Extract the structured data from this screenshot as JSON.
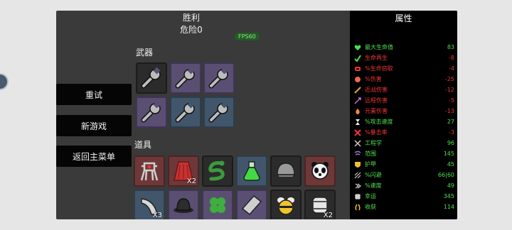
{
  "header": {
    "title": "胜利",
    "danger": "危险0",
    "fps": "FPS60"
  },
  "menu": {
    "retry": "重试",
    "new_game": "新游戏",
    "main_menu": "返回主菜单"
  },
  "weapons": {
    "label": "武器",
    "slots": [
      {
        "icon": "wrench-icon",
        "tier": "common"
      },
      {
        "icon": "wrench-icon",
        "tier": "epic"
      },
      {
        "icon": "wrench-icon",
        "tier": "epic"
      },
      {
        "icon": "wrench-icon",
        "tier": "epic"
      },
      {
        "icon": "wrench-icon",
        "tier": "rare"
      },
      {
        "icon": "wrench-icon",
        "tier": "rare"
      }
    ]
  },
  "items": {
    "label": "道具",
    "slots": [
      {
        "icon": "robot-frame-icon",
        "tier": "legendary",
        "count": ""
      },
      {
        "icon": "red-cape-icon",
        "tier": "legendary",
        "count": "X2"
      },
      {
        "icon": "snake-icon",
        "tier": "common",
        "count": ""
      },
      {
        "icon": "potion-icon",
        "tier": "rare",
        "count": ""
      },
      {
        "icon": "helmet-icon",
        "tier": "common",
        "count": ""
      },
      {
        "icon": "panda-icon",
        "tier": "common",
        "count": ""
      },
      {
        "icon": "horn-icon",
        "tier": "rare",
        "count": "X3"
      },
      {
        "icon": "bowler-hat-icon",
        "tier": "epic",
        "count": ""
      },
      {
        "icon": "clover-icon",
        "tier": "epic",
        "count": ""
      },
      {
        "icon": "crystal-icon",
        "tier": "epic",
        "count": ""
      },
      {
        "icon": "bee-icon",
        "tier": "common",
        "count": ""
      },
      {
        "icon": "barrel-icon",
        "tier": "common",
        "count": "X2"
      }
    ]
  },
  "stats": {
    "title": "属性",
    "rows": [
      {
        "icon": "heart-icon",
        "name": "最大生命值",
        "value": "83",
        "color": "#4ee04e"
      },
      {
        "icon": "regen-icon",
        "name": "生命再生",
        "value": "-8",
        "color": "#ef3535"
      },
      {
        "icon": "lifesteal-icon",
        "name": "%生命窃取",
        "value": "-4",
        "color": "#ef3535"
      },
      {
        "icon": "damage-icon",
        "name": "%伤害",
        "value": "-25",
        "color": "#ef3535"
      },
      {
        "icon": "melee-icon",
        "name": "近战伤害",
        "value": "-12",
        "color": "#ef3535"
      },
      {
        "icon": "ranged-icon",
        "name": "远程伤害",
        "value": "-5",
        "color": "#ef3535"
      },
      {
        "icon": "elemental-icon",
        "name": "元素伤害",
        "value": "-13",
        "color": "#ef3535"
      },
      {
        "icon": "attack-speed-icon",
        "name": "%攻击速度",
        "value": "27",
        "color": "#4ee04e"
      },
      {
        "icon": "crit-icon",
        "name": "%暴击率",
        "value": "-3",
        "color": "#ef3535"
      },
      {
        "icon": "engineering-icon",
        "name": "工程学",
        "value": "96",
        "color": "#4ee04e"
      },
      {
        "icon": "range-icon",
        "name": "范围",
        "value": "145",
        "color": "#4ee04e"
      },
      {
        "icon": "armor-icon",
        "name": "护甲",
        "value": "45",
        "color": "#4ee04e"
      },
      {
        "icon": "dodge-icon",
        "name": "%闪避",
        "value": "66|60",
        "color": "#4ee04e"
      },
      {
        "icon": "speed-icon",
        "name": "%速度",
        "value": "49",
        "color": "#4ee04e"
      },
      {
        "icon": "luck-icon",
        "name": "幸运",
        "value": "345",
        "color": "#4ee04e"
      },
      {
        "icon": "harvest-icon",
        "name": "收获",
        "value": "114",
        "color": "#4ee04e"
      }
    ]
  }
}
